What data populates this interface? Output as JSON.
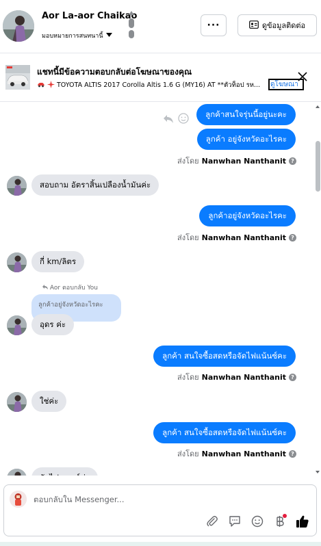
{
  "header": {
    "contact_name": "Aor La-aor Chaikao",
    "assign_label": "มอบหมายการสนทนานี้",
    "more_label": "···",
    "contact_info_label": "ดูข้อมูลติดต่อ"
  },
  "ad_banner": {
    "title": "แชทนี้มีข้อความตอบกลับต่อโฆษณาของคุณ",
    "ad_text": "TOYOTA ALTIS 2017 Corolla Altis 1.6 G (MY16) AT **ตัวท็อป รห...",
    "view_ad_link": "ดูโฆษณา"
  },
  "messages": {
    "m1": "ลูกค้าสนใจรุ่นนี้อยู่นะคะ",
    "m2": "ลูกค้า อยู่จังหวัดอะไรคะ",
    "sent_by_label": "ส่งโดย",
    "sender_name": "Nanwhan Nanthanit",
    "m3": "สอบถาม อัตราสิ้นเปลืองน้ำมันค่ะ",
    "m4": "ลูกค้าอยู่จังหวัดอะไรคะ",
    "m5": "กี่ km/ลิตร",
    "reply_label": "Aor ตอบกลับ You",
    "reply_quote": "ลูกค้าอยู่จังหวัดอะไรคะ",
    "m6": "อุดร ค่ะ",
    "m7": "ลูกค้า สนใจซื้อสดหรือจัดไฟแน้นซ์คะ",
    "m8": "ใช่ค่ะ",
    "m9": "ลูกค้า สนใจซื้อสดหรือจัดไฟแน้นซ์คะ",
    "m10_partial": "จัดไฟแนนซ์ค่ะ"
  },
  "composer": {
    "placeholder": "ตอบกลับใน Messenger..."
  },
  "colors": {
    "outgoing_bubble": "#0a7cff",
    "incoming_bubble": "#e4e6eb",
    "reply_quote_bg": "#cfe1fb",
    "link": "#1b74e4"
  }
}
